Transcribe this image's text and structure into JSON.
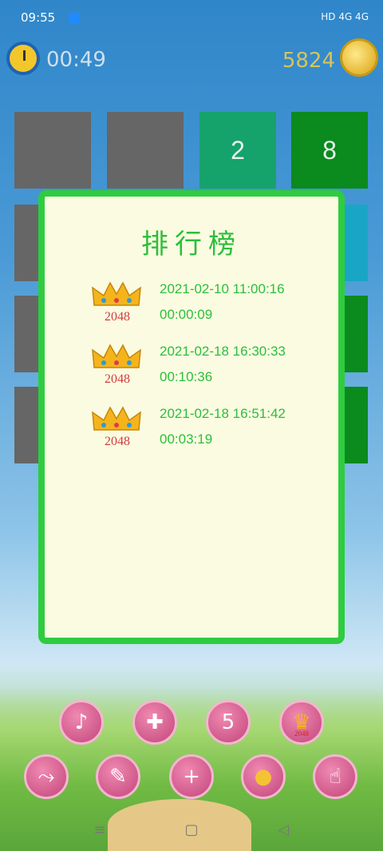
{
  "status_bar": {
    "time": "09:55",
    "icons": "HD 4G 4G"
  },
  "top_bar": {
    "timer": "00:49",
    "score": "5824"
  },
  "grid": {
    "tiles": [
      {
        "label": "",
        "color": "#666666"
      },
      {
        "label": "",
        "color": "#666666"
      },
      {
        "label": "2",
        "color": "#15a36b"
      },
      {
        "label": "8",
        "color": "#0b8a1e"
      },
      {
        "label": "",
        "color": "#666666"
      },
      {
        "label": "",
        "color": "#666666"
      },
      {
        "label": "",
        "color": "#5aa6c1"
      },
      {
        "label": "",
        "color": "#19a6c6"
      },
      {
        "label": "",
        "color": "#666666"
      },
      {
        "label": "",
        "color": "#666666"
      },
      {
        "label": "",
        "color": "#5aa6c1"
      },
      {
        "label": "",
        "color": "#0b8a1e"
      },
      {
        "label": "",
        "color": "#666666"
      },
      {
        "label": "",
        "color": "#666666"
      },
      {
        "label": "",
        "color": "#5aa6c1"
      },
      {
        "label": "",
        "color": "#0b8a1e"
      }
    ]
  },
  "leaderboard": {
    "title": "排行榜",
    "records": [
      {
        "label": "2048",
        "date": "2021-02-10 11:00:16",
        "duration": "00:00:09"
      },
      {
        "label": "2048",
        "date": "2021-02-18 16:30:33",
        "duration": "00:10:36"
      },
      {
        "label": "2048",
        "date": "2021-02-18 16:51:42",
        "duration": "00:03:19"
      }
    ]
  },
  "bottom_buttons": {
    "rank_label": "2048",
    "undo_count": "5"
  },
  "colors": {
    "accent_green": "#2ecc40",
    "modal_bg": "#fbfbe1",
    "button_pink": "#d65a90"
  }
}
